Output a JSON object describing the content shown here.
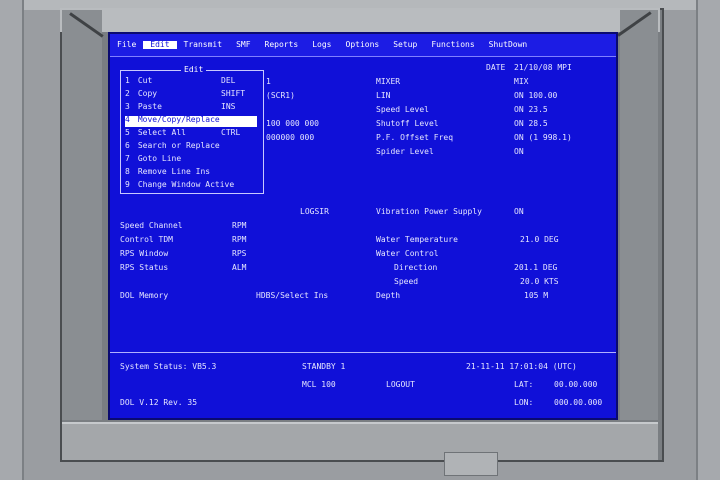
{
  "menu": [
    "File",
    "Edit",
    "Transmit",
    "SMF",
    "Reports",
    "Logs",
    "Options",
    "Setup",
    "Functions",
    "ShutDown"
  ],
  "header": {
    "tab_label": "Edit",
    "right_label": "DATE",
    "right_value": "21/10/08 MPI"
  },
  "dropdown": {
    "title": "Edit",
    "items": [
      {
        "num": "1",
        "label": "Cut",
        "value": "DEL"
      },
      {
        "num": "2",
        "label": "Copy",
        "value": "SHIFT"
      },
      {
        "num": "3",
        "label": "Paste",
        "value": "INS"
      },
      {
        "num": "4",
        "label": "Move/Copy/Replace",
        "value": ""
      },
      {
        "num": "5",
        "label": "Select All",
        "value": "CTRL"
      },
      {
        "num": "6",
        "label": "Search or Replace",
        "value": ""
      },
      {
        "num": "7",
        "label": "Goto Line",
        "value": ""
      },
      {
        "num": "8",
        "label": "Remove Line Ins",
        "value": ""
      },
      {
        "num": "9",
        "label": "Change Window Active",
        "value": ""
      }
    ]
  },
  "left_fields": [
    {
      "label": "Speed Channel",
      "value": "RPM"
    },
    {
      "label": "Control TDM",
      "value": "RPM"
    },
    {
      "label": "RPS Window",
      "value": "RPS"
    },
    {
      "label": "RPS Status",
      "value": "ALM"
    }
  ],
  "mid_values": [
    "1",
    "(SCR1)",
    "100 000 000",
    "000000 000"
  ],
  "right_fields": [
    {
      "label": "MIXER",
      "value": "MIX"
    },
    {
      "label": "LIN",
      "value": "ON  100.00"
    },
    {
      "label": "Speed Level",
      "value": "ON  23.5"
    },
    {
      "label": "Shutoff Level",
      "value": "ON  28.5"
    },
    {
      "label": "P.F. Offset Freq",
      "value": "ON  (1 998.1)"
    },
    {
      "label": "Spider Level",
      "value": "ON"
    }
  ],
  "line_items": [
    {
      "label": "",
      "value": "LOGSIR"
    },
    {
      "label": "Vibration Power Supply",
      "value": "ON"
    }
  ],
  "water": {
    "temp_label": "Water Temperature",
    "temp_value": "21.0 DEG",
    "control_label": "Water Control",
    "direction_label": "Direction",
    "direction_value": "201.1 DEG",
    "speed_label": "Speed",
    "speed_value": "20.0 KTS",
    "depth_label": "Depth",
    "depth_value": "105 M"
  },
  "dol": {
    "label": "DOL Memory",
    "value": "HDBS/Select Ins"
  },
  "status": {
    "system_label": "System Status: VB5.3",
    "standby_label": "STANDBY 1",
    "date_time": "21-11-11 17:01:04 (UTC)",
    "mcl_label": "MCL 100",
    "logout": "LOGOUT",
    "lat_label": "LAT:",
    "lat_value": "00.00.000",
    "lon_label": "LON:",
    "lon_value": "000.00.000",
    "dol_ver": "DOL V.12 Rev. 35"
  }
}
